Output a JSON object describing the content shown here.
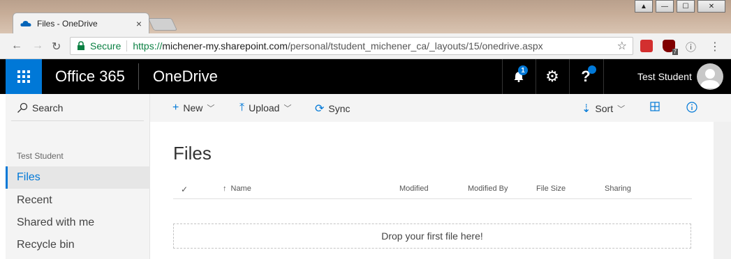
{
  "browser": {
    "tab_title": "Files - OneDrive",
    "tab_close": "×",
    "window_buttons": [
      "▲",
      "—",
      "☐",
      "✕"
    ],
    "secure_label": "Secure",
    "url_scheme": "https://",
    "url_host": "michener-my.sharepoint.com",
    "url_path": "/personal/tstudent_michener_ca/_layouts/15/onedrive.aspx",
    "extension_badge": "7"
  },
  "header": {
    "brand": "Office 365",
    "app_name": "OneDrive",
    "notification_count": "1",
    "user_name": "Test Student",
    "accent": "#0078d7"
  },
  "sidebar": {
    "search_label": "Search",
    "section_label": "Test Student",
    "items": [
      {
        "label": "Files",
        "active": true
      },
      {
        "label": "Recent"
      },
      {
        "label": "Shared with me"
      },
      {
        "label": "Recycle bin"
      }
    ]
  },
  "commandbar": {
    "new_label": "New",
    "upload_label": "Upload",
    "sync_label": "Sync",
    "sort_label": "Sort"
  },
  "main": {
    "title": "Files",
    "columns": [
      "Name",
      "Modified",
      "Modified By",
      "File Size",
      "Sharing"
    ],
    "dropzone_text": "Drop your first file here!"
  }
}
